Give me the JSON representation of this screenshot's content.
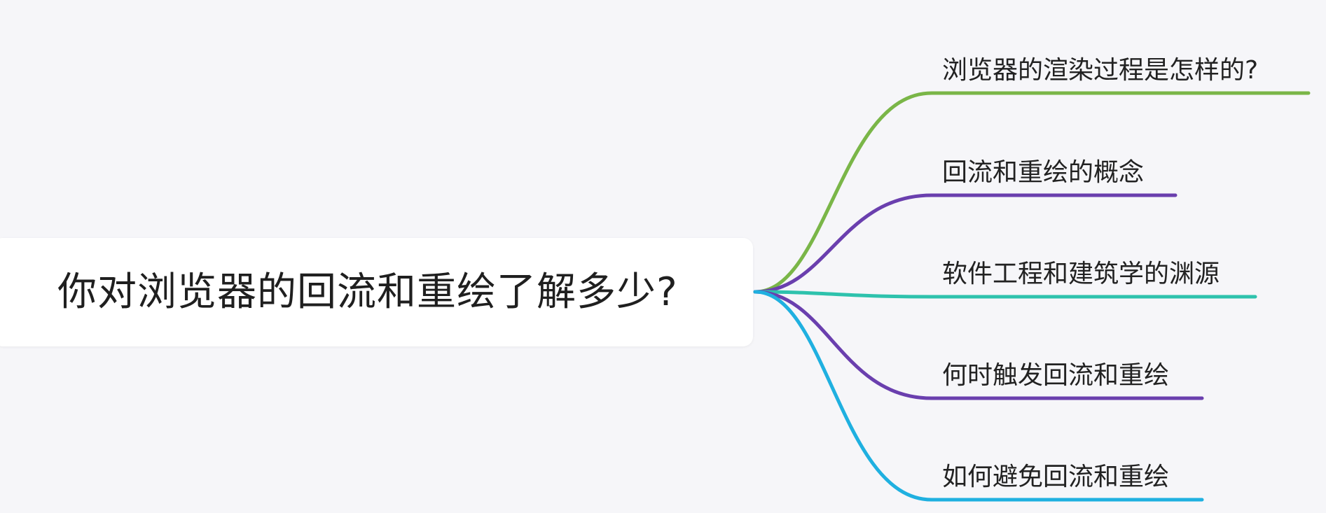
{
  "root": {
    "text": "你对浏览器的回流和重绘了解多少?"
  },
  "branches": [
    {
      "label": "浏览器的渲染过程是怎样的?",
      "color": "#7ab648"
    },
    {
      "label": "回流和重绘的概念",
      "color": "#6a3fae"
    },
    {
      "label": "软件工程和建筑学的渊源",
      "color": "#2ec2ad"
    },
    {
      "label": "何时触发回流和重绘",
      "color": "#6a3fae"
    },
    {
      "label": "如何避免回流和重绘",
      "color": "#1fb0e0"
    }
  ]
}
